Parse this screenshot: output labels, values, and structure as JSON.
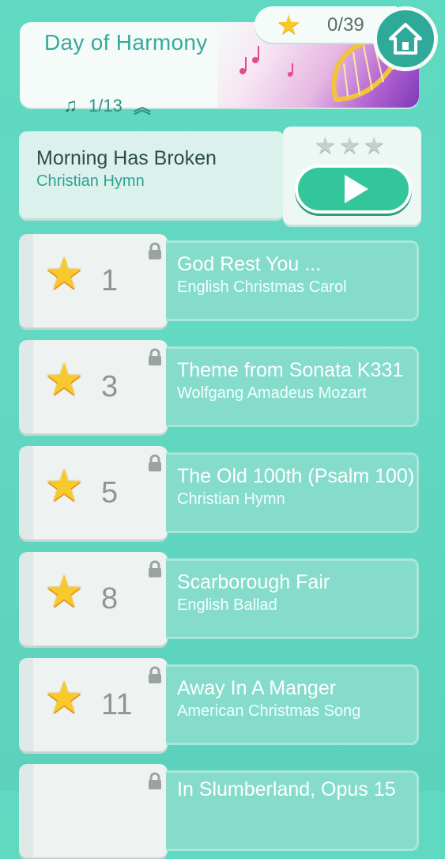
{
  "header": {
    "title": "Day of Harmony",
    "level_progress": "1/13",
    "star_count": "0/39"
  },
  "current_song": {
    "title": "Morning Has Broken",
    "subtitle": "Christian Hymn",
    "stars_earned": 0,
    "stars_total": 3
  },
  "songs": [
    {
      "required_stars": "1",
      "title": "God Rest You ...",
      "subtitle": "English Christmas Carol"
    },
    {
      "required_stars": "3",
      "title": "Theme from Sonata K331",
      "subtitle": "Wolfgang Amadeus Mozart"
    },
    {
      "required_stars": "5",
      "title": "The Old 100th (Psalm 100)",
      "subtitle": "Christian Hymn"
    },
    {
      "required_stars": "8",
      "title": "Scarborough Fair",
      "subtitle": "English Ballad"
    },
    {
      "required_stars": "11",
      "title": "Away In A Manger",
      "subtitle": "American Christmas Song"
    },
    {
      "required_stars": "",
      "title": "In Slumberland, Opus 15",
      "subtitle": ""
    }
  ],
  "colors": {
    "background": "#5fd9c1",
    "accent": "#2fa99a",
    "star": "#f8c92d",
    "play": "#33c69a"
  }
}
